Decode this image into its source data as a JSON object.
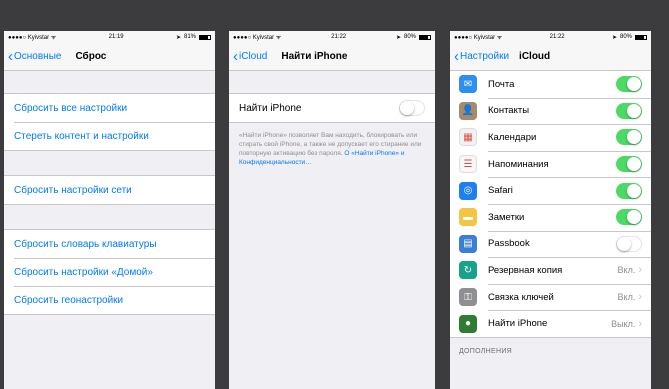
{
  "screen1": {
    "status": {
      "carrier": "●●●●○ Kyivstar ᯤ",
      "time": "21:19",
      "battery": "81%",
      "battery_level": 0.81
    },
    "nav": {
      "back_label": "Основные",
      "title": "Сброс"
    },
    "groups": [
      [
        "Сбросить все настройки",
        "Стереть контент и настройки"
      ],
      [
        "Сбросить настройки сети"
      ],
      [
        "Сбросить словарь клавиатуры",
        "Сбросить настройки «Домой»",
        "Сбросить геонастройки"
      ]
    ]
  },
  "screen2": {
    "status": {
      "carrier": "●●●●○ Kyivstar ᯤ",
      "time": "21:22",
      "battery": "80%",
      "battery_level": 0.8
    },
    "nav": {
      "back_label": "iCloud",
      "title": "Найти iPhone"
    },
    "toggle_row": {
      "label": "Найти iPhone",
      "on": false
    },
    "footnote": "«Найти iPhone» позволяет Вам находить, блокировать или стирать свой iPhone, а также не допускает его стирание или повторную активацию без пароля.",
    "footnote_link": "О «Найти iPhone» и Конфиденциальности…"
  },
  "screen3": {
    "status": {
      "carrier": "●●●●○ Kyivstar ᯤ",
      "time": "21:22",
      "battery": "80%",
      "battery_level": 0.8
    },
    "nav": {
      "back_label": "Настройки",
      "title": "iCloud"
    },
    "rows": [
      {
        "label": "Почта",
        "icon": "mail-icon",
        "glyph": "✉",
        "color": "#2f8ff0",
        "kind": "toggle",
        "on": true
      },
      {
        "label": "Контакты",
        "icon": "contacts-icon",
        "glyph": "👤",
        "color": "#a8896a",
        "kind": "toggle",
        "on": true
      },
      {
        "label": "Календари",
        "icon": "calendar-icon",
        "glyph": "▦",
        "color": "#f2f2f2",
        "kind": "toggle",
        "on": true
      },
      {
        "label": "Напоминания",
        "icon": "reminders-icon",
        "glyph": "☰",
        "color": "#f7f7f7",
        "kind": "toggle",
        "on": true
      },
      {
        "label": "Safari",
        "icon": "safari-icon",
        "glyph": "◎",
        "color": "#1d7ff0",
        "kind": "toggle",
        "on": true
      },
      {
        "label": "Заметки",
        "icon": "notes-icon",
        "glyph": "▬",
        "color": "#f5c443",
        "kind": "toggle",
        "on": true
      },
      {
        "label": "Passbook",
        "icon": "passbook-icon",
        "glyph": "▤",
        "color": "#3a7ed6",
        "kind": "toggle",
        "on": false
      },
      {
        "label": "Резервная копия",
        "icon": "backup-icon",
        "glyph": "↻",
        "color": "#16a38a",
        "kind": "detail",
        "detail": "Вкл."
      },
      {
        "label": "Связка ключей",
        "icon": "keychain-icon",
        "glyph": "⚿",
        "color": "#8e8e93",
        "kind": "detail",
        "detail": "Вкл."
      },
      {
        "label": "Найти iPhone",
        "icon": "find-iphone-icon",
        "glyph": "●",
        "color": "#2e7d32",
        "kind": "detail",
        "detail": "Выкл."
      }
    ],
    "section_header": "ДОПОЛНЕНИЯ"
  }
}
